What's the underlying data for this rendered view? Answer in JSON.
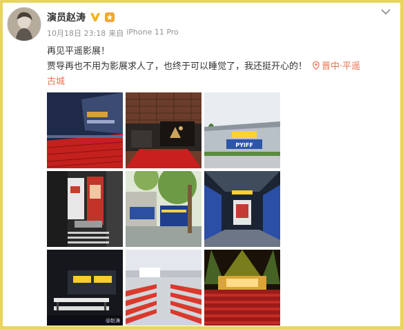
{
  "post": {
    "username": "演员赵涛",
    "verified_badge_icon": "verified-v-icon",
    "fan_badge_icon": "fan-badge-icon",
    "timestamp": "10月18日 23:18",
    "source_prefix": "来自",
    "source_device": "iPhone 11 Pro",
    "text_line1": "再见平遥影展！",
    "text_line2": "贾导再也不用为影展求人了，也终于可以睡觉了，我还挺开心的！",
    "location_part1": "晋中·平遥",
    "location_part2": "古城",
    "location_icon": "location-pin-icon",
    "menu_icon": "chevron-down-icon"
  },
  "photos": [
    {
      "alt": "red-seats-building-night"
    },
    {
      "alt": "red-carpet-entrance"
    },
    {
      "alt": "pyiff-building-exterior"
    },
    {
      "alt": "poster-staircase"
    },
    {
      "alt": "trees-courtyard-booths"
    },
    {
      "alt": "indoor-hall-blue-panels"
    },
    {
      "alt": "stage-tables-dark-room"
    },
    {
      "alt": "outdoor-red-seats"
    },
    {
      "alt": "theater-stage-lights"
    }
  ],
  "photo_labels": {
    "pyiff_sign": "PYIFF",
    "watermark": "@赵涛"
  },
  "colors": {
    "frame": "#e8d55c",
    "link": "#eb7350",
    "text": "#333333",
    "meta": "#939393"
  }
}
